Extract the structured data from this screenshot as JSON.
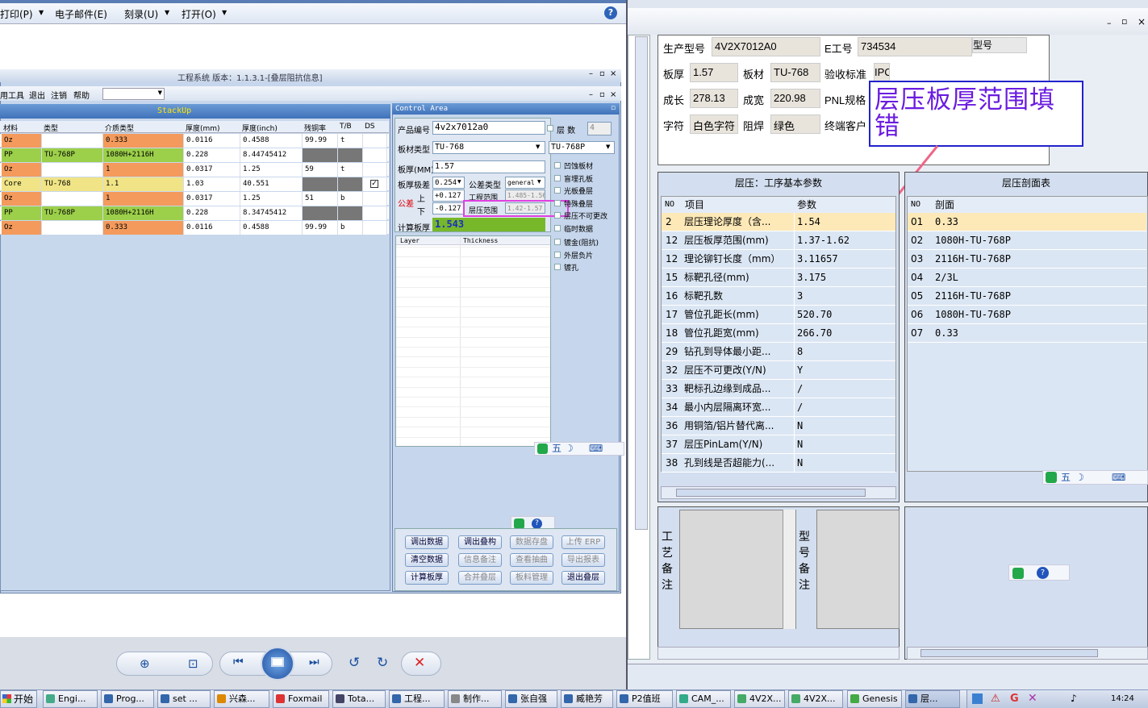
{
  "outlook": {
    "menu": [
      "打印(P)",
      "电子邮件(E)",
      "刻录(U)",
      "打开(O)"
    ]
  },
  "eng": {
    "title": "工程系统 版本：1.1.3.1-[叠层阻抗信息]",
    "menu": [
      "用工具",
      "退出",
      "注销",
      "帮助"
    ],
    "stackup_title": "StackUp",
    "headers": [
      "材料",
      "类型",
      "介质类型",
      "厚度(mm)",
      "厚度(inch)",
      "残铜率",
      "T/B",
      "DS"
    ],
    "rows": [
      [
        "Oz",
        "",
        "0.333",
        "0.0116",
        "0.4588",
        "99.99",
        "t",
        ""
      ],
      [
        "PP",
        "TU-768P",
        "1080H+2116H",
        "0.228",
        "8.44745412",
        "",
        "",
        ""
      ],
      [
        "Oz",
        "",
        "1",
        "0.0317",
        "1.25",
        "59",
        "t",
        ""
      ],
      [
        "Core",
        "TU-768",
        "1.1",
        "1.03",
        "40.551",
        "",
        "",
        ""
      ],
      [
        "Oz",
        "",
        "1",
        "0.0317",
        "1.25",
        "51",
        "b",
        ""
      ],
      [
        "PP",
        "TU-768P",
        "1080H+2116H",
        "0.228",
        "8.34745412",
        "",
        "",
        ""
      ],
      [
        "Oz",
        "",
        "0.333",
        "0.0116",
        "0.4588",
        "99.99",
        "b",
        ""
      ]
    ],
    "control": {
      "title": "Control Area",
      "product_label": "产品编号",
      "product_value": "4v2x7012a0",
      "layers_label": "层 数",
      "layers_value": "4",
      "material_label": "板材类型",
      "material_value": "TU-768",
      "material2_value": "TU-768P",
      "thickness_label": "板厚(MM)",
      "thickness_value": "1.57",
      "tol_label": "板厚极差",
      "tol_value": "0.254",
      "tol_type_label": "公差类型",
      "tol_type_value": "general",
      "gongcha_label": "公差",
      "up_label": "上",
      "down_label": "下",
      "up_value": "+0.127",
      "down_value": "-0.127",
      "eng_range_label": "工程范围",
      "eng_range_value": "1.485-1.56",
      "lam_range_label": "层压范围",
      "lam_range_value": "1.42-1.57",
      "calc_label": "计算板厚",
      "calc_value": "1.543",
      "layer_col": "Layer",
      "thick_col": "Thickness",
      "checks": [
        "凹蚀板材",
        "盲埋孔板",
        "光板叠层",
        "特殊叠层",
        "层压不可更改",
        "临时数据",
        "镀金(阻抗)",
        "外层负片",
        "镀孔"
      ],
      "buttons": [
        [
          "调出数据",
          "调出叠构",
          "数据存盘",
          "上传 ERP"
        ],
        [
          "清空数据",
          "信息备注",
          "查看抽曲",
          "导出报表"
        ],
        [
          "计算板厚",
          "合并叠层",
          "板料管理",
          "退出叠层"
        ]
      ]
    }
  },
  "right": {
    "info": {
      "prod_label": "生产型号",
      "prod_value": "4V2X7012A0",
      "e_label": "E工号",
      "e_value": "734534",
      "type_label": "型号",
      "thick_label": "板厚",
      "thick_value": "1.57",
      "mat_label": "板材",
      "mat_value": "TU-768",
      "std_label": "验收标准",
      "std_value": "IPC",
      "len_label": "成长",
      "len_value": "278.13",
      "wid_label": "成宽",
      "wid_value": "220.98",
      "pnl_label": "PNL规格",
      "char_label": "字符",
      "char_value": "白色字符",
      "mask_label": "阻焊",
      "mask_value": "绿色",
      "cust_label": "终端客户"
    },
    "annotation": "层压板厚范围填错",
    "params": {
      "title": "层压：工序基本参数",
      "h_no": "NO",
      "h_item": "项目",
      "h_param": "参数",
      "rows": [
        [
          "2",
          "层压理论厚度（含...",
          "1.54"
        ],
        [
          "12",
          "层压板厚范围(mm)",
          "1.37-1.62"
        ],
        [
          "12",
          "理论铆钉长度（mm）",
          "3.11657"
        ],
        [
          "15",
          "标靶孔径(mm)",
          "3.175"
        ],
        [
          "16",
          "标靶孔数",
          "3"
        ],
        [
          "17",
          "管位孔距长(mm)",
          "520.70"
        ],
        [
          "18",
          "管位孔距宽(mm)",
          "266.70"
        ],
        [
          "29",
          "钻孔到导体最小距...",
          "8"
        ],
        [
          "32",
          "层压不可更改(Y/N)",
          "Y"
        ],
        [
          "33",
          "靶标孔边缘到成品...",
          "/"
        ],
        [
          "34",
          "最小内层隔离环宽...",
          "/"
        ],
        [
          "36",
          "用铜箔/铝片替代离...",
          "N"
        ],
        [
          "37",
          "层压PinLam(Y/N)",
          "N"
        ],
        [
          "38",
          "孔到线是否超能力(...",
          "N"
        ]
      ]
    },
    "section": {
      "title": "层压剖面表",
      "h_no": "NO",
      "h_item": "剖面",
      "rows": [
        [
          "01",
          "0.33"
        ],
        [
          "02",
          "1080H-TU-768P"
        ],
        [
          "03",
          "2116H-TU-768P"
        ],
        [
          "04",
          "2/3L"
        ],
        [
          "05",
          "2116H-TU-768P"
        ],
        [
          "06",
          "1080H-TU-768P"
        ],
        [
          "07",
          "0.33"
        ]
      ]
    },
    "notes": {
      "process": "工艺备注",
      "model": "型号备注"
    },
    "ime": "五"
  },
  "taskbar": {
    "start": "开始",
    "items": [
      "Engi...",
      "Prog...",
      "set ...",
      "兴森...",
      "Foxmail",
      "Tota...",
      "工程...",
      "制作...",
      "张自强",
      "臧艳芳",
      "P2值班",
      "CAM_...",
      "4V2X...",
      "4V2X...",
      "Genesis",
      "层..."
    ],
    "time": "14:24"
  }
}
